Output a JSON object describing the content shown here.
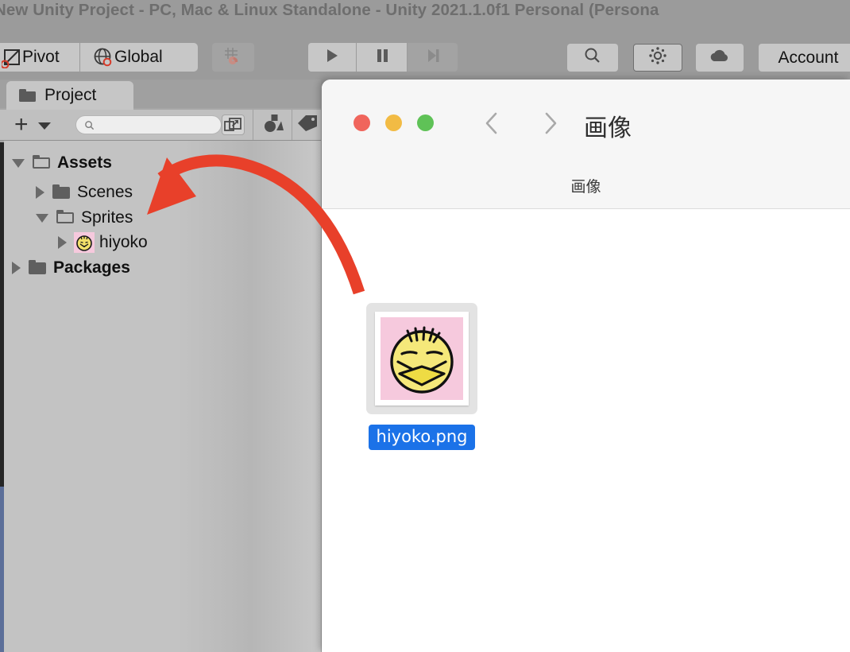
{
  "unity": {
    "title": "New Unity Project - PC, Mac & Linux Standalone - Unity 2021.1.0f1 Personal (Persona",
    "toolbar": {
      "pivot_label": "Pivot",
      "global_label": "Global",
      "pivot_icon": "pivot-rotate-icon",
      "global_icon": "globe-icon",
      "snap_icon": "grid-snap-icon",
      "play_icon": "play-icon",
      "pause_icon": "pause-icon",
      "step_icon": "step-forward-icon",
      "search_icon": "search-icon",
      "collab_icon": "services-dots-icon",
      "cloud_icon": "cloud-icon",
      "account_label": "Account"
    }
  },
  "project_panel": {
    "tab_label": "Project",
    "tab_icon": "folder-icon",
    "toolbar": {
      "create_label": "+",
      "create_icon": "plus-icon",
      "create_caret_icon": "caret-down-icon",
      "search_placeholder": "",
      "search_value": "",
      "search_icon": "search-icon",
      "expand_icon": "expand-window-icon",
      "filter_shapes_icon": "asset-type-filter-icon",
      "filter_label_icon": "tag-filter-icon"
    },
    "tree": [
      {
        "label": "Assets",
        "icon": "folder-open-icon",
        "expanded": true,
        "bold": true,
        "depth": 0
      },
      {
        "label": "Scenes",
        "icon": "folder-closed-icon",
        "expanded": false,
        "bold": false,
        "depth": 1
      },
      {
        "label": "Sprites",
        "icon": "folder-open-icon",
        "expanded": true,
        "bold": false,
        "depth": 1
      },
      {
        "label": "hiyoko",
        "icon": "hiyoko-sprite-icon",
        "expanded": false,
        "bold": false,
        "depth": 2
      },
      {
        "label": "Packages",
        "icon": "folder-closed-icon",
        "expanded": false,
        "bold": true,
        "depth": 0
      }
    ]
  },
  "finder": {
    "title": "画像",
    "breadcrumb": "画像",
    "back_icon": "chevron-left-icon",
    "forward_icon": "chevron-right-icon",
    "close_icon": "traffic-light-close",
    "minimize_icon": "traffic-light-minimize",
    "maximize_icon": "traffic-light-maximize",
    "files": [
      {
        "name": "hiyoko.png",
        "icon": "hiyoko-image-thumbnail",
        "selected": true
      }
    ]
  },
  "annotation": {
    "arrow_color": "#e8402a",
    "description_icon": "curved-arrow-annotation"
  },
  "colors": {
    "unity_chrome": "#9b9b9b",
    "unity_panel": "#c3c3c3",
    "finder_chrome": "#f6f6f6",
    "selection_blue": "#1b72e8",
    "annotation_red": "#e8402a",
    "sprite_pink": "#f6c9dd",
    "sprite_yellow": "#f5e87a"
  }
}
